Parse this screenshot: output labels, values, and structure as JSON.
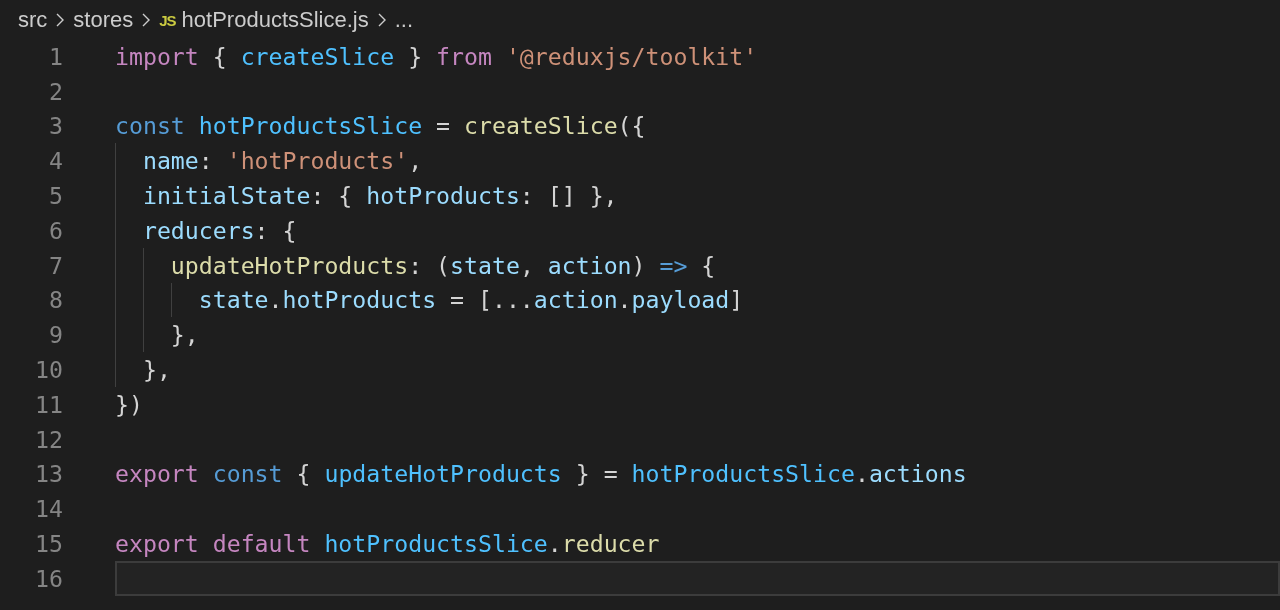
{
  "breadcrumb": [
    {
      "kind": "folder",
      "label": "src"
    },
    {
      "kind": "folder",
      "label": "stores"
    },
    {
      "kind": "js-file",
      "badge": "JS",
      "label": "hotProductsSlice.js"
    },
    {
      "kind": "more",
      "label": "..."
    }
  ],
  "editor": {
    "lines": [
      {
        "number": "1",
        "current": false,
        "tokens": [
          {
            "kind": "keyword",
            "text": "import"
          },
          {
            "kind": "punct",
            "text": " { "
          },
          {
            "kind": "variable",
            "text": "createSlice"
          },
          {
            "kind": "punct",
            "text": " } "
          },
          {
            "kind": "keyword",
            "text": "from"
          },
          {
            "kind": "string",
            "text": " '@reduxjs/toolkit'"
          }
        ]
      },
      {
        "number": "2",
        "current": false
      },
      {
        "number": "3",
        "current": false,
        "tokens": [
          {
            "kind": "storage",
            "text": "const"
          },
          {
            "kind": "variable",
            "text": " hotProductsSlice"
          },
          {
            "kind": "punct",
            "text": " = "
          },
          {
            "kind": "function",
            "text": "createSlice"
          },
          {
            "kind": "punct",
            "text": "({"
          }
        ]
      },
      {
        "number": "4",
        "current": false,
        "tokens": [
          {
            "kind": "property",
            "text": "  name"
          },
          {
            "kind": "punct",
            "text": ": "
          },
          {
            "kind": "string",
            "text": "'hotProducts'"
          },
          {
            "kind": "punct",
            "text": ","
          }
        ]
      },
      {
        "number": "5",
        "current": false,
        "tokens": [
          {
            "kind": "property",
            "text": "  initialState"
          },
          {
            "kind": "punct",
            "text": ": { "
          },
          {
            "kind": "property",
            "text": "hotProducts"
          },
          {
            "kind": "punct",
            "text": ": [] },"
          }
        ]
      },
      {
        "number": "6",
        "current": false,
        "tokens": [
          {
            "kind": "property",
            "text": "  reducers"
          },
          {
            "kind": "punct",
            "text": ": {"
          }
        ]
      },
      {
        "number": "7",
        "current": false,
        "tokens": [
          {
            "kind": "function",
            "text": "    updateHotProducts"
          },
          {
            "kind": "punct",
            "text": ": ("
          },
          {
            "kind": "property",
            "text": "state"
          },
          {
            "kind": "punct",
            "text": ", "
          },
          {
            "kind": "property",
            "text": "action"
          },
          {
            "kind": "punct",
            "text": ") "
          },
          {
            "kind": "storage",
            "text": "=>"
          },
          {
            "kind": "punct",
            "text": " {"
          }
        ]
      },
      {
        "number": "8",
        "current": false,
        "tokens": [
          {
            "kind": "property",
            "text": "      state"
          },
          {
            "kind": "punct",
            "text": "."
          },
          {
            "kind": "property",
            "text": "hotProducts"
          },
          {
            "kind": "punct",
            "text": " = [..."
          },
          {
            "kind": "property",
            "text": "action"
          },
          {
            "kind": "punct",
            "text": "."
          },
          {
            "kind": "property",
            "text": "payload"
          },
          {
            "kind": "punct",
            "text": "]"
          }
        ]
      },
      {
        "number": "9",
        "current": false,
        "tokens": [
          {
            "kind": "punct",
            "text": "    },"
          }
        ]
      },
      {
        "number": "10",
        "current": false,
        "tokens": [
          {
            "kind": "punct",
            "text": "  },"
          }
        ]
      },
      {
        "number": "11",
        "current": false,
        "tokens": [
          {
            "kind": "punct",
            "text": "})"
          }
        ]
      },
      {
        "number": "12",
        "current": false
      },
      {
        "number": "13",
        "current": false,
        "tokens": [
          {
            "kind": "keyword",
            "text": "export"
          },
          {
            "kind": "storage",
            "text": " const"
          },
          {
            "kind": "punct",
            "text": " { "
          },
          {
            "kind": "variable",
            "text": "updateHotProducts"
          },
          {
            "kind": "punct",
            "text": " } = "
          },
          {
            "kind": "variable",
            "text": "hotProductsSlice"
          },
          {
            "kind": "punct",
            "text": "."
          },
          {
            "kind": "property",
            "text": "actions"
          }
        ]
      },
      {
        "number": "14",
        "current": false
      },
      {
        "number": "15",
        "current": false,
        "tokens": [
          {
            "kind": "keyword",
            "text": "export"
          },
          {
            "kind": "keyword",
            "text": " default"
          },
          {
            "kind": "variable",
            "text": " hotProductsSlice"
          },
          {
            "kind": "punct",
            "text": "."
          },
          {
            "kind": "function",
            "text": "reducer"
          }
        ]
      },
      {
        "number": "16",
        "current": true
      }
    ]
  }
}
